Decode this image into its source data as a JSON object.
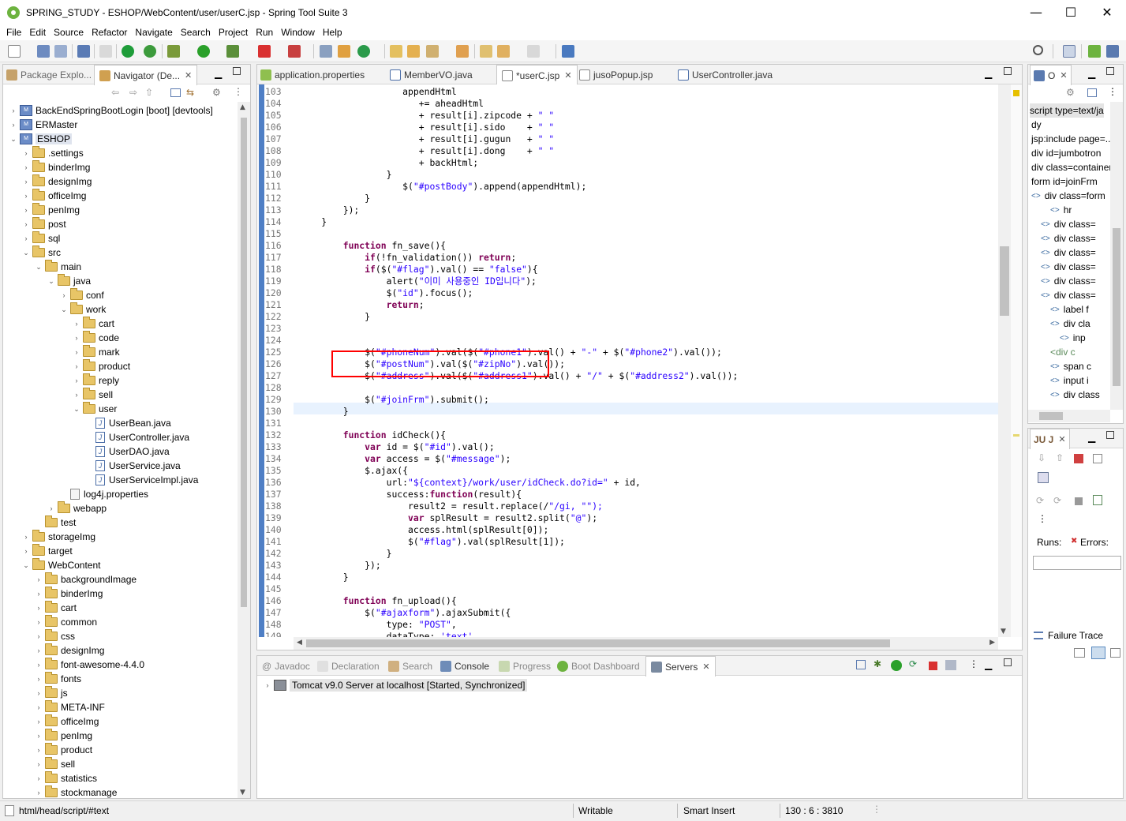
{
  "window": {
    "title": "SPRING_STUDY - ESHOP/WebContent/user/userC.jsp - Spring Tool Suite 3",
    "minimize": "—",
    "maximize": "☐",
    "close": "✕"
  },
  "menu": [
    "File",
    "Edit",
    "Source",
    "Refactor",
    "Navigate",
    "Search",
    "Project",
    "Run",
    "Window",
    "Help"
  ],
  "left_panel": {
    "tabs": [
      {
        "label": "Package Explo..."
      },
      {
        "label": "Navigator (De..."
      }
    ],
    "tree": [
      {
        "label": "BackEndSpringBootLogin [boot] [devtools]",
        "depth": 0,
        "type": "project",
        "exp": "closed"
      },
      {
        "label": "ERMaster",
        "depth": 0,
        "type": "project",
        "exp": "closed"
      },
      {
        "label": "ESHOP",
        "depth": 0,
        "type": "project",
        "exp": "open",
        "sel": true
      },
      {
        "label": ".settings",
        "depth": 1,
        "type": "folder",
        "exp": "closed"
      },
      {
        "label": "binderImg",
        "depth": 1,
        "type": "folder",
        "exp": "closed"
      },
      {
        "label": "designImg",
        "depth": 1,
        "type": "folder",
        "exp": "closed"
      },
      {
        "label": "officeImg",
        "depth": 1,
        "type": "folder",
        "exp": "closed"
      },
      {
        "label": "penImg",
        "depth": 1,
        "type": "folder",
        "exp": "closed"
      },
      {
        "label": "post",
        "depth": 1,
        "type": "folder",
        "exp": "closed"
      },
      {
        "label": "sql",
        "depth": 1,
        "type": "folder",
        "exp": "closed"
      },
      {
        "label": "src",
        "depth": 1,
        "type": "folder",
        "exp": "open"
      },
      {
        "label": "main",
        "depth": 2,
        "type": "folder",
        "exp": "open"
      },
      {
        "label": "java",
        "depth": 3,
        "type": "folder",
        "exp": "open"
      },
      {
        "label": "conf",
        "depth": 4,
        "type": "folder",
        "exp": "closed"
      },
      {
        "label": "work",
        "depth": 4,
        "type": "folder",
        "exp": "open"
      },
      {
        "label": "cart",
        "depth": 5,
        "type": "folder",
        "exp": "closed"
      },
      {
        "label": "code",
        "depth": 5,
        "type": "folder",
        "exp": "closed"
      },
      {
        "label": "mark",
        "depth": 5,
        "type": "folder",
        "exp": "closed"
      },
      {
        "label": "product",
        "depth": 5,
        "type": "folder",
        "exp": "closed"
      },
      {
        "label": "reply",
        "depth": 5,
        "type": "folder",
        "exp": "closed"
      },
      {
        "label": "sell",
        "depth": 5,
        "type": "folder",
        "exp": "closed"
      },
      {
        "label": "user",
        "depth": 5,
        "type": "folder",
        "exp": "open"
      },
      {
        "label": "UserBean.java",
        "depth": 6,
        "type": "java",
        "exp": "none"
      },
      {
        "label": "UserController.java",
        "depth": 6,
        "type": "java",
        "exp": "none"
      },
      {
        "label": "UserDAO.java",
        "depth": 6,
        "type": "java",
        "exp": "none"
      },
      {
        "label": "UserService.java",
        "depth": 6,
        "type": "java",
        "exp": "none"
      },
      {
        "label": "UserServiceImpl.java",
        "depth": 6,
        "type": "java",
        "exp": "none"
      },
      {
        "label": "log4j.properties",
        "depth": 4,
        "type": "file",
        "exp": "none"
      },
      {
        "label": "webapp",
        "depth": 3,
        "type": "folder",
        "exp": "closed"
      },
      {
        "label": "test",
        "depth": 2,
        "type": "folder",
        "exp": "none"
      },
      {
        "label": "storageImg",
        "depth": 1,
        "type": "folder",
        "exp": "closed"
      },
      {
        "label": "target",
        "depth": 1,
        "type": "folder",
        "exp": "closed"
      },
      {
        "label": "WebContent",
        "depth": 1,
        "type": "folder",
        "exp": "open"
      },
      {
        "label": "backgroundImage",
        "depth": 2,
        "type": "folder",
        "exp": "closed"
      },
      {
        "label": "binderImg",
        "depth": 2,
        "type": "folder",
        "exp": "closed"
      },
      {
        "label": "cart",
        "depth": 2,
        "type": "folder",
        "exp": "closed"
      },
      {
        "label": "common",
        "depth": 2,
        "type": "folder",
        "exp": "closed"
      },
      {
        "label": "css",
        "depth": 2,
        "type": "folder",
        "exp": "closed"
      },
      {
        "label": "designImg",
        "depth": 2,
        "type": "folder",
        "exp": "closed"
      },
      {
        "label": "font-awesome-4.4.0",
        "depth": 2,
        "type": "folder",
        "exp": "closed"
      },
      {
        "label": "fonts",
        "depth": 2,
        "type": "folder",
        "exp": "closed"
      },
      {
        "label": "js",
        "depth": 2,
        "type": "folder",
        "exp": "closed"
      },
      {
        "label": "META-INF",
        "depth": 2,
        "type": "folder",
        "exp": "closed"
      },
      {
        "label": "officeImg",
        "depth": 2,
        "type": "folder",
        "exp": "closed"
      },
      {
        "label": "penImg",
        "depth": 2,
        "type": "folder",
        "exp": "closed"
      },
      {
        "label": "product",
        "depth": 2,
        "type": "folder",
        "exp": "closed"
      },
      {
        "label": "sell",
        "depth": 2,
        "type": "folder",
        "exp": "closed"
      },
      {
        "label": "statistics",
        "depth": 2,
        "type": "folder",
        "exp": "closed"
      },
      {
        "label": "stockmanage",
        "depth": 2,
        "type": "folder",
        "exp": "closed"
      }
    ]
  },
  "editor": {
    "tabs": [
      {
        "label": "application.properties",
        "active": false
      },
      {
        "label": "MemberVO.java",
        "active": false
      },
      {
        "label": "*userC.jsp",
        "active": true
      },
      {
        "label": "jusoPopup.jsp",
        "active": false
      },
      {
        "label": "UserController.java",
        "active": false
      }
    ],
    "lines": [
      {
        "n": "103",
        "code": "                    appendHtml"
      },
      {
        "n": "104",
        "code": "                       += aheadHtml"
      },
      {
        "n": "105",
        "code": "                       + result[i].zipcode + \" \""
      },
      {
        "n": "106",
        "code": "                       + result[i].sido    + \" \""
      },
      {
        "n": "107",
        "code": "                       + result[i].gugun   + \" \""
      },
      {
        "n": "108",
        "code": "                       + result[i].dong    + \" \""
      },
      {
        "n": "109",
        "code": "                       + backHtml;"
      },
      {
        "n": "110",
        "code": "                 }"
      },
      {
        "n": "111",
        "code": "                    $(\"#postBody\").append(appendHtml);"
      },
      {
        "n": "112",
        "code": "             }"
      },
      {
        "n": "113",
        "code": "         });"
      },
      {
        "n": "114",
        "code": "     }"
      },
      {
        "n": "115",
        "code": ""
      },
      {
        "n": "116",
        "code": "         function fn_save(){"
      },
      {
        "n": "117",
        "code": "             if(!fn_validation()) return;"
      },
      {
        "n": "118",
        "code": "             if($(\"#flag\").val() == \"false\"){"
      },
      {
        "n": "119",
        "code": "                 alert(\"이미 사용중인 ID입니다\");"
      },
      {
        "n": "120",
        "code": "                 $(\"id\").focus();"
      },
      {
        "n": "121",
        "code": "                 return;"
      },
      {
        "n": "122",
        "code": "             }"
      },
      {
        "n": "123",
        "code": ""
      },
      {
        "n": "124",
        "code": ""
      },
      {
        "n": "125",
        "code": "             $(\"#phoneNum\").val($(\"#phone1\").val() + \"-\" + $(\"#phone2\").val());"
      },
      {
        "n": "126",
        "code": "             $(\"#postNum\").val($(\"#zipNo\").val());"
      },
      {
        "n": "127",
        "code": "             $(\"#address\").val($(\"#address1\").val() + \"/\" + $(\"#address2\").val());"
      },
      {
        "n": "128",
        "code": ""
      },
      {
        "n": "129",
        "code": "             $(\"#joinFrm\").submit();"
      },
      {
        "n": "130",
        "code": "         }"
      },
      {
        "n": "131",
        "code": ""
      },
      {
        "n": "132",
        "code": "         function idCheck(){"
      },
      {
        "n": "133",
        "code": "             var id = $(\"#id\").val();"
      },
      {
        "n": "134",
        "code": "             var access = $(\"#message\");"
      },
      {
        "n": "135",
        "code": "             $.ajax({"
      },
      {
        "n": "136",
        "code": "                 url:\"${context}/work/user/idCheck.do?id=\" + id,"
      },
      {
        "n": "137",
        "code": "                 success:function(result){"
      },
      {
        "n": "138",
        "code": "                     result2 = result.replace(/\"/gi, \"\");"
      },
      {
        "n": "139",
        "code": "                     var splResult = result2.split(\"@\");"
      },
      {
        "n": "140",
        "code": "                     access.html(splResult[0]);"
      },
      {
        "n": "141",
        "code": "                     $(\"#flag\").val(splResult[1]);"
      },
      {
        "n": "142",
        "code": "                 }"
      },
      {
        "n": "143",
        "code": "             });"
      },
      {
        "n": "144",
        "code": "         }"
      },
      {
        "n": "145",
        "code": ""
      },
      {
        "n": "146",
        "code": "         function fn_upload(){"
      },
      {
        "n": "147",
        "code": "             $(\"#ajaxform\").ajaxSubmit({"
      },
      {
        "n": "148",
        "code": "                 type: \"POST\","
      },
      {
        "n": "149",
        "code": "                 dataType: 'text',"
      }
    ]
  },
  "outline": {
    "tab": "O",
    "rows": [
      {
        "text": "script type=text/ja",
        "kind": "head"
      },
      {
        "text": "dy",
        "kind": "plain"
      },
      {
        "text": "jsp:include page=...",
        "kind": "plain"
      },
      {
        "text": "div id=jumbotron",
        "kind": "plain"
      },
      {
        "text": "div class=container",
        "kind": "plain"
      },
      {
        "text": "form id=joinFrm",
        "kind": "plain"
      },
      {
        "text": "div class=form",
        "kind": "tag"
      },
      {
        "text": "hr",
        "kind": "tag"
      },
      {
        "text": "div class=",
        "kind": "tag"
      },
      {
        "text": "div class=",
        "kind": "tag"
      },
      {
        "text": "div class=",
        "kind": "tag"
      },
      {
        "text": "div class=",
        "kind": "tag"
      },
      {
        "text": "div class=",
        "kind": "tag"
      },
      {
        "text": "div class=",
        "kind": "tag"
      },
      {
        "text": "label f",
        "kind": "tag"
      },
      {
        "text": "div cla",
        "kind": "tag"
      },
      {
        "text": "inp",
        "kind": "tag"
      },
      {
        "text": "<div c",
        "kind": "comment"
      },
      {
        "text": "span c",
        "kind": "tag"
      },
      {
        "text": "input i",
        "kind": "tag"
      },
      {
        "text": "div class",
        "kind": "tag"
      }
    ]
  },
  "junit": {
    "tab": "JU J",
    "runs_label": "Runs:",
    "errors_label": "Errors:",
    "failure_trace": "Failure Trace"
  },
  "bottom": {
    "tabs": [
      {
        "label": "Javadoc",
        "active": false
      },
      {
        "label": "Declaration",
        "active": false
      },
      {
        "label": "Search",
        "active": false
      },
      {
        "label": "Console",
        "active": false
      },
      {
        "label": "Progress",
        "active": false
      },
      {
        "label": "Boot Dashboard",
        "active": false
      },
      {
        "label": "Servers",
        "active": true
      }
    ],
    "server": "Tomcat v9.0 Server at localhost  [Started, Synchronized]"
  },
  "statusbar": {
    "path": "html/head/script/#text",
    "mode": "Writable",
    "insert": "Smart Insert",
    "position": "130 : 6 : 3810"
  },
  "colors": {
    "selection_box": "#ff0000",
    "current_line": "#e8f2fe",
    "keyword": "#7f0055",
    "string": "#2a00ff"
  }
}
